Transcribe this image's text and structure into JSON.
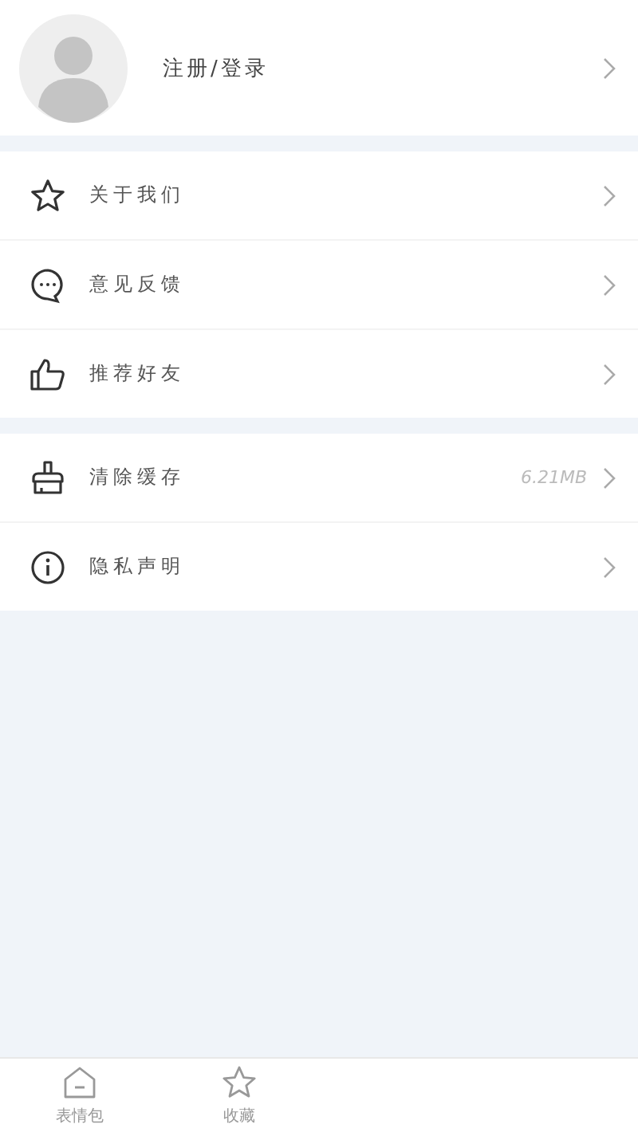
{
  "profile": {
    "label": "注册/登录"
  },
  "menu_groups": [
    {
      "items": [
        {
          "kind": "star",
          "label": "关于我们"
        },
        {
          "kind": "chat",
          "label": "意见反馈"
        },
        {
          "kind": "thumb",
          "label": "推荐好友"
        }
      ]
    },
    {
      "items": [
        {
          "kind": "broom",
          "label": "清除缓存",
          "value": "6.21MB"
        },
        {
          "kind": "info",
          "label": "隐私声明"
        }
      ]
    }
  ],
  "tab_bar": [
    {
      "kind": "home",
      "label": "表情包",
      "selected": false
    },
    {
      "kind": "star",
      "label": "收藏",
      "selected": false
    }
  ]
}
